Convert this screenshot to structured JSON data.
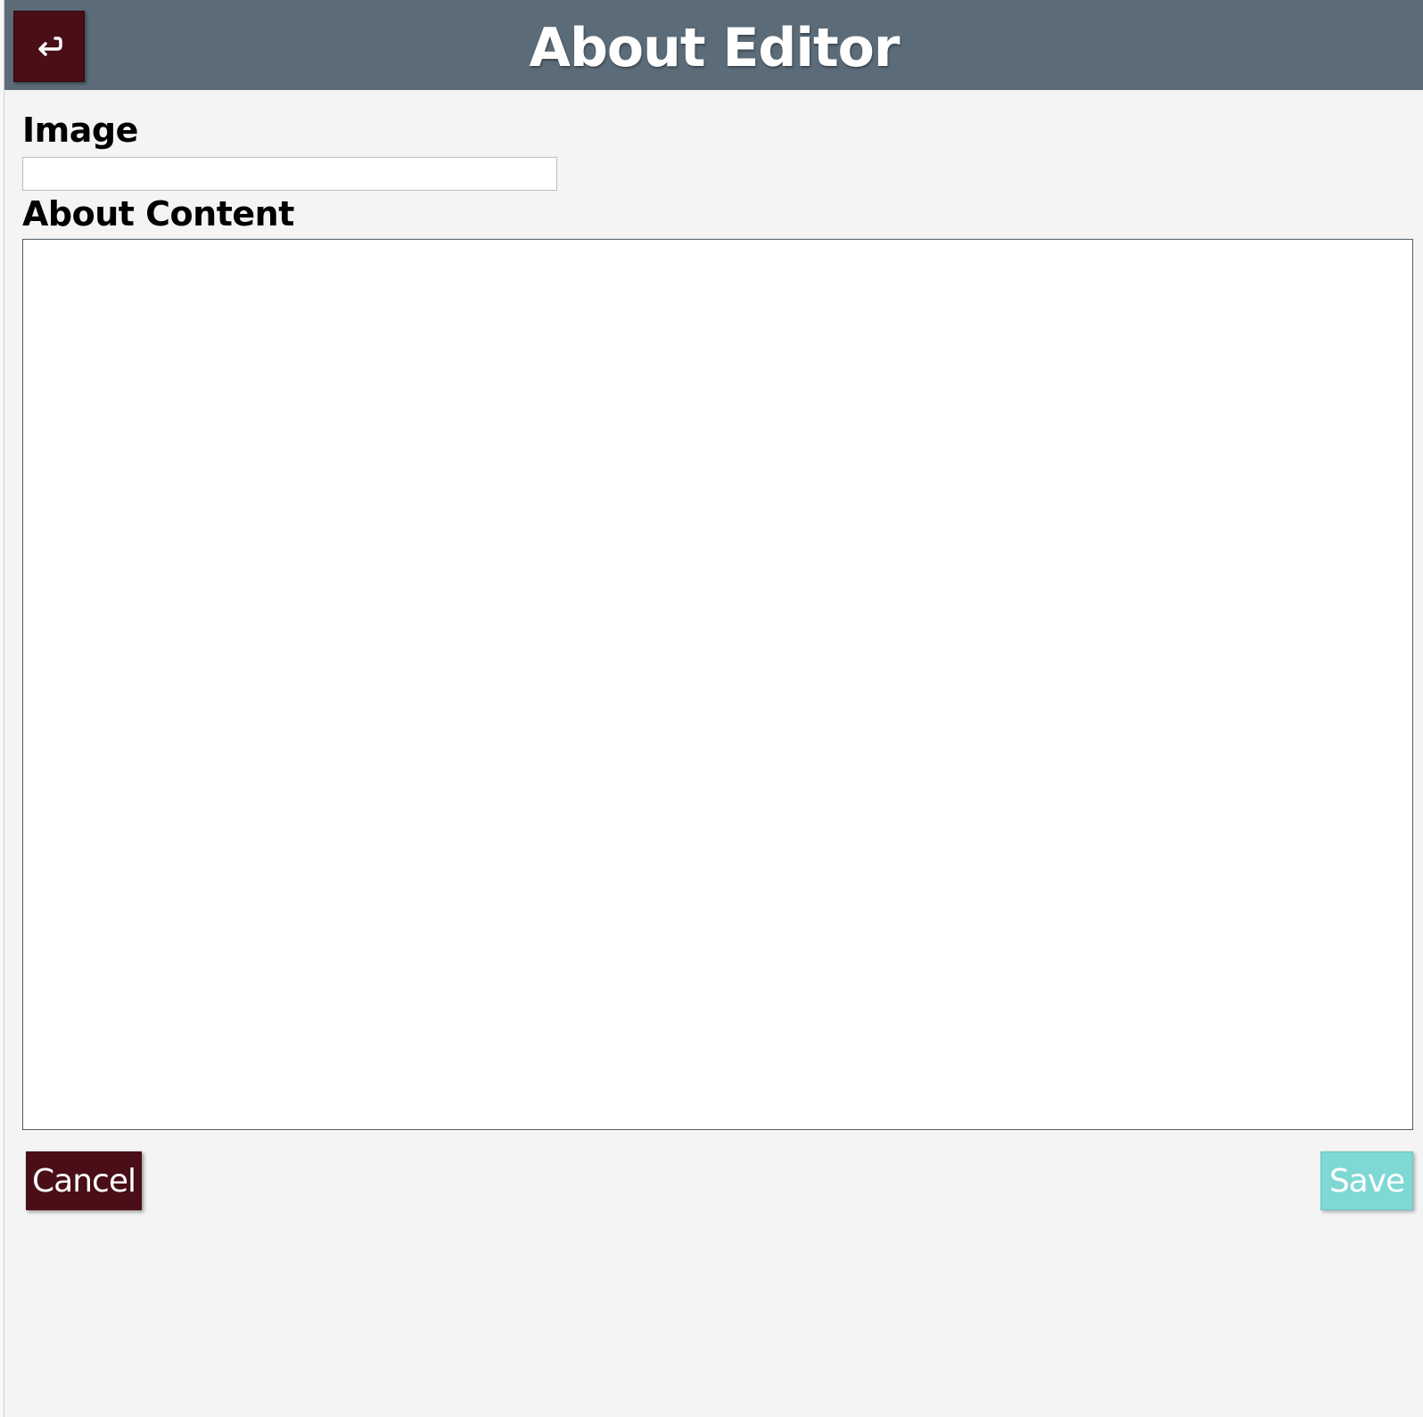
{
  "header": {
    "title": "About Editor",
    "back_icon": "return-arrow-icon",
    "background_color": "#5b6b78"
  },
  "form": {
    "image_label": "Image",
    "image_value": "",
    "content_label": "About Content",
    "content_value": ""
  },
  "actions": {
    "cancel_label": "Cancel",
    "save_label": "Save",
    "cancel_color": "#4a0e17",
    "save_color": "#7fd8d4",
    "save_enabled": false
  }
}
